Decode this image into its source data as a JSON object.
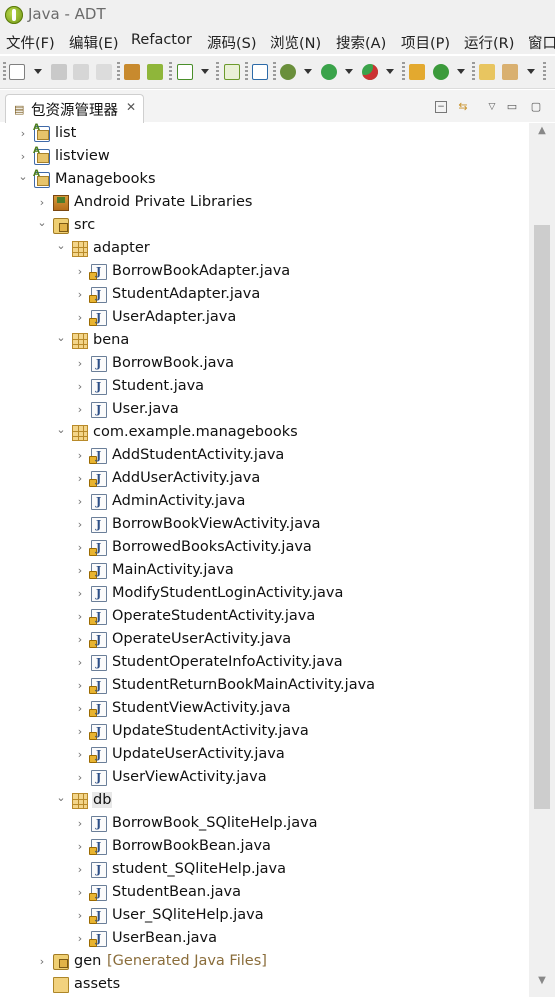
{
  "window": {
    "title": "Java  -  ADT"
  },
  "menu": [
    "文件(F)",
    "编辑(E)",
    "Refactor",
    "源码(S)",
    "浏览(N)",
    "搜索(A)",
    "项目(P)",
    "运行(R)",
    "窗口"
  ],
  "view": {
    "title": "包资源管理器",
    "close": "✕"
  },
  "tree": [
    {
      "label": "list",
      "icon": "project-icon",
      "expanded": false,
      "depth": 0
    },
    {
      "label": "listview",
      "icon": "project-icon",
      "expanded": false,
      "depth": 0
    },
    {
      "label": "Managebooks",
      "icon": "project-icon",
      "expanded": true,
      "depth": 0
    },
    {
      "label": "Android Private Libraries",
      "icon": "library-icon",
      "expanded": false,
      "depth": 1
    },
    {
      "label": "src",
      "icon": "source-folder-icon",
      "expanded": true,
      "depth": 1
    },
    {
      "label": "adapter",
      "icon": "package-icon",
      "expanded": true,
      "depth": 2
    },
    {
      "label": "BorrowBookAdapter.java",
      "icon": "java-file-icon",
      "expanded": false,
      "depth": 3
    },
    {
      "label": "StudentAdapter.java",
      "icon": "java-file-icon",
      "expanded": false,
      "depth": 3
    },
    {
      "label": "UserAdapter.java",
      "icon": "java-file-icon",
      "expanded": false,
      "depth": 3
    },
    {
      "label": "bena",
      "icon": "package-icon",
      "expanded": true,
      "depth": 2
    },
    {
      "label": "BorrowBook.java",
      "icon": "java-file-icon",
      "expanded": false,
      "depth": 3
    },
    {
      "label": "Student.java",
      "icon": "java-file-icon",
      "expanded": false,
      "depth": 3
    },
    {
      "label": "User.java",
      "icon": "java-file-icon",
      "expanded": false,
      "depth": 3
    },
    {
      "label": "com.example.managebooks",
      "icon": "package-icon",
      "expanded": true,
      "depth": 2
    },
    {
      "label": "AddStudentActivity.java",
      "icon": "java-file-icon",
      "expanded": false,
      "depth": 3
    },
    {
      "label": "AddUserActivity.java",
      "icon": "java-file-icon",
      "expanded": false,
      "depth": 3
    },
    {
      "label": "AdminActivity.java",
      "icon": "java-file-icon",
      "expanded": false,
      "depth": 3
    },
    {
      "label": "BorrowBookViewActivity.java",
      "icon": "java-file-icon",
      "expanded": false,
      "depth": 3
    },
    {
      "label": "BorrowedBooksActivity.java",
      "icon": "java-file-icon",
      "expanded": false,
      "depth": 3
    },
    {
      "label": "MainActivity.java",
      "icon": "java-file-icon",
      "expanded": false,
      "depth": 3
    },
    {
      "label": "ModifyStudentLoginActivity.java",
      "icon": "java-file-icon",
      "expanded": false,
      "depth": 3
    },
    {
      "label": "OperateStudentActivity.java",
      "icon": "java-file-icon",
      "expanded": false,
      "depth": 3
    },
    {
      "label": "OperateUserActivity.java",
      "icon": "java-file-icon",
      "expanded": false,
      "depth": 3
    },
    {
      "label": "StudentOperateInfoActivity.java",
      "icon": "java-file-icon",
      "expanded": false,
      "depth": 3
    },
    {
      "label": "StudentReturnBookMainActivity.java",
      "icon": "java-file-icon",
      "expanded": false,
      "depth": 3
    },
    {
      "label": "StudentViewActivity.java",
      "icon": "java-file-icon",
      "expanded": false,
      "depth": 3
    },
    {
      "label": "UpdateStudentActivity.java",
      "icon": "java-file-icon",
      "expanded": false,
      "depth": 3
    },
    {
      "label": "UpdateUserActivity.java",
      "icon": "java-file-icon",
      "expanded": false,
      "depth": 3
    },
    {
      "label": "UserViewActivity.java",
      "icon": "java-file-icon",
      "expanded": false,
      "depth": 3
    },
    {
      "label": "db",
      "icon": "package-icon",
      "expanded": true,
      "depth": 2,
      "selected": true
    },
    {
      "label": "BorrowBook_SQliteHelp.java",
      "icon": "java-file-icon",
      "expanded": false,
      "depth": 3
    },
    {
      "label": "BorrowBookBean.java",
      "icon": "java-file-icon",
      "expanded": false,
      "depth": 3
    },
    {
      "label": "student_SQliteHelp.java",
      "icon": "java-file-icon",
      "expanded": false,
      "depth": 3
    },
    {
      "label": "StudentBean.java",
      "icon": "java-file-icon",
      "expanded": false,
      "depth": 3
    },
    {
      "label": "User_SQliteHelp.java",
      "icon": "java-file-icon",
      "expanded": false,
      "depth": 3
    },
    {
      "label": "UserBean.java",
      "icon": "java-file-icon",
      "expanded": false,
      "depth": 3
    },
    {
      "label": "gen",
      "decoration": "[Generated Java Files]",
      "icon": "source-folder-icon",
      "expanded": false,
      "depth": 1
    },
    {
      "label": "assets",
      "icon": "folder-icon",
      "expanded": null,
      "depth": 1
    }
  ]
}
